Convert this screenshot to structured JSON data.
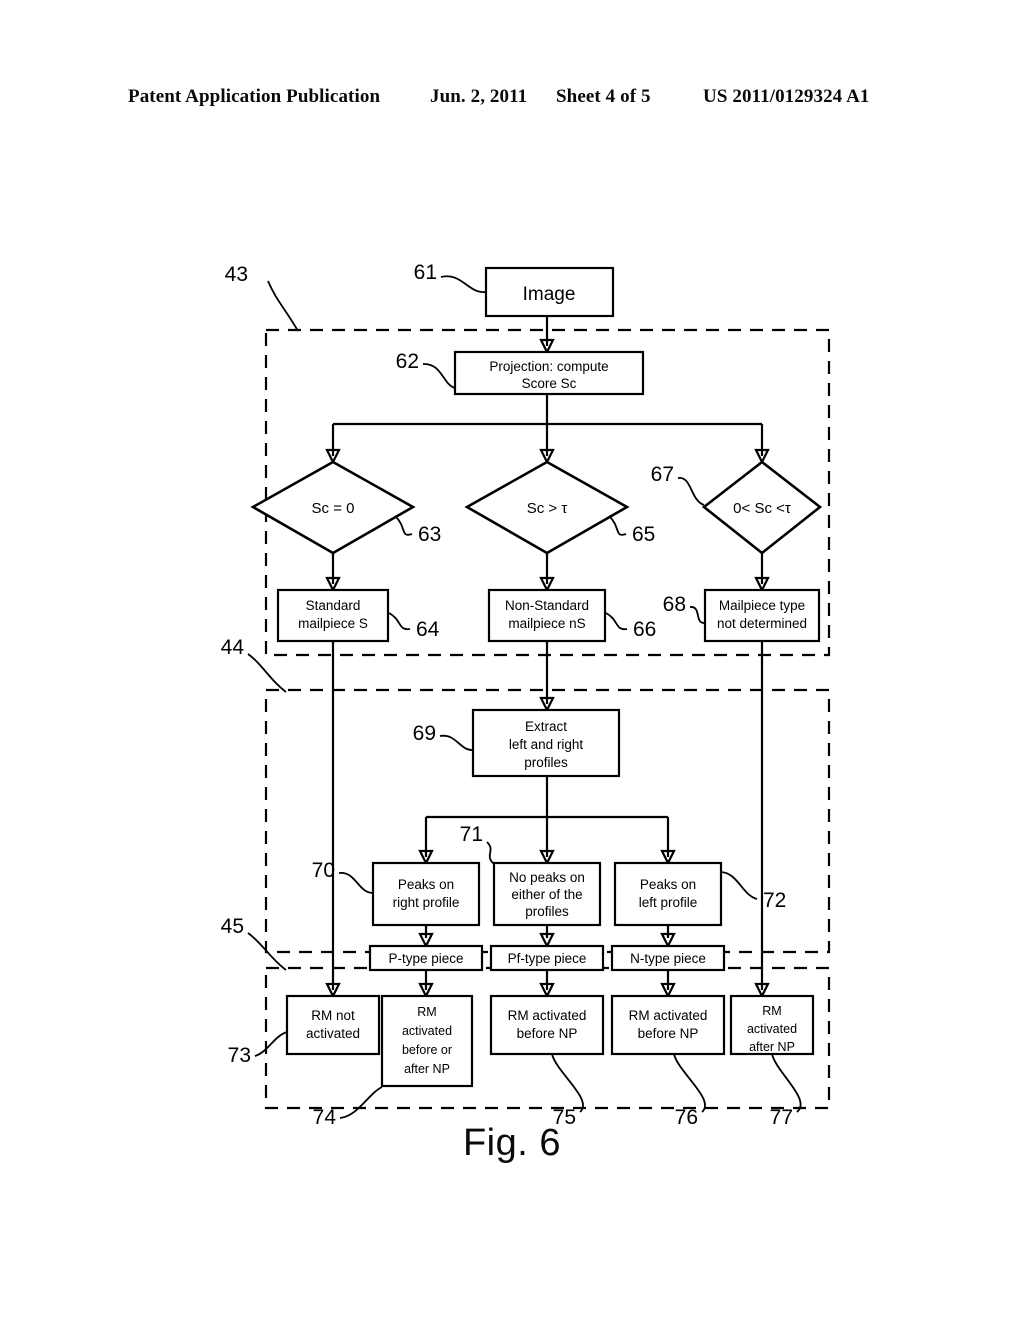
{
  "header": {
    "title": "Patent Application Publication",
    "date": "Jun. 2, 2011",
    "sheet": "Sheet 4 of 5",
    "number": "US 2011/0129324 A1"
  },
  "figure": {
    "caption": "Fig. 6",
    "zone_labels": [
      {
        "id": "z43",
        "ref": "43"
      },
      {
        "id": "z44",
        "ref": "44"
      },
      {
        "id": "z45",
        "ref": "45"
      }
    ],
    "nodes": [
      {
        "id": "n61",
        "ref": "61",
        "shape": "rect",
        "lines": [
          "Image"
        ]
      },
      {
        "id": "n62",
        "ref": "62",
        "shape": "rect",
        "lines": [
          "Projection: compute",
          "Score Sc"
        ]
      },
      {
        "id": "n63",
        "ref": "63",
        "shape": "diamond",
        "lines": [
          "Sc = 0"
        ]
      },
      {
        "id": "n65",
        "ref": "65",
        "shape": "diamond",
        "lines": [
          "Sc > τ"
        ]
      },
      {
        "id": "n67",
        "ref": "67",
        "shape": "diamond",
        "lines": [
          "0< Sc <τ"
        ]
      },
      {
        "id": "n64",
        "ref": "64",
        "shape": "rect",
        "lines": [
          "Standard",
          "mailpiece S"
        ]
      },
      {
        "id": "n66",
        "ref": "66",
        "shape": "rect",
        "lines": [
          "Non-Standard",
          "mailpiece nS"
        ]
      },
      {
        "id": "n68",
        "ref": "68",
        "shape": "rect",
        "lines": [
          "Mailpiece type",
          "not determined"
        ]
      },
      {
        "id": "n69",
        "ref": "69",
        "shape": "rect",
        "lines": [
          "Extract",
          "left and right",
          "profiles"
        ]
      },
      {
        "id": "n70",
        "ref": "70",
        "shape": "rect",
        "lines": [
          "Peaks on",
          "right profile"
        ]
      },
      {
        "id": "n71",
        "ref": "71",
        "shape": "rect",
        "lines": [
          "No peaks on",
          "either of the",
          "profiles"
        ]
      },
      {
        "id": "n72",
        "ref": "72",
        "shape": "rect",
        "lines": [
          "Peaks on",
          "left profile"
        ]
      },
      {
        "id": "np",
        "ref": "",
        "shape": "rect",
        "lines": [
          "P-type piece"
        ]
      },
      {
        "id": "npf",
        "ref": "",
        "shape": "rect",
        "lines": [
          "Pf-type piece"
        ]
      },
      {
        "id": "nn",
        "ref": "",
        "shape": "rect",
        "lines": [
          "N-type  piece"
        ]
      },
      {
        "id": "n73",
        "ref": "73",
        "shape": "rect",
        "lines": [
          "RM not",
          "activated"
        ]
      },
      {
        "id": "n74",
        "ref": "74",
        "shape": "rect",
        "lines": [
          "RM",
          "activated",
          "before or",
          "after NP"
        ]
      },
      {
        "id": "n75",
        "ref": "75",
        "shape": "rect",
        "lines": [
          "RM activated",
          "before NP"
        ]
      },
      {
        "id": "n76",
        "ref": "76",
        "shape": "rect",
        "lines": [
          "RM activated",
          "before NP"
        ]
      },
      {
        "id": "n77",
        "ref": "77",
        "shape": "rect",
        "lines": [
          "RM",
          "activated",
          "after NP"
        ]
      }
    ]
  }
}
